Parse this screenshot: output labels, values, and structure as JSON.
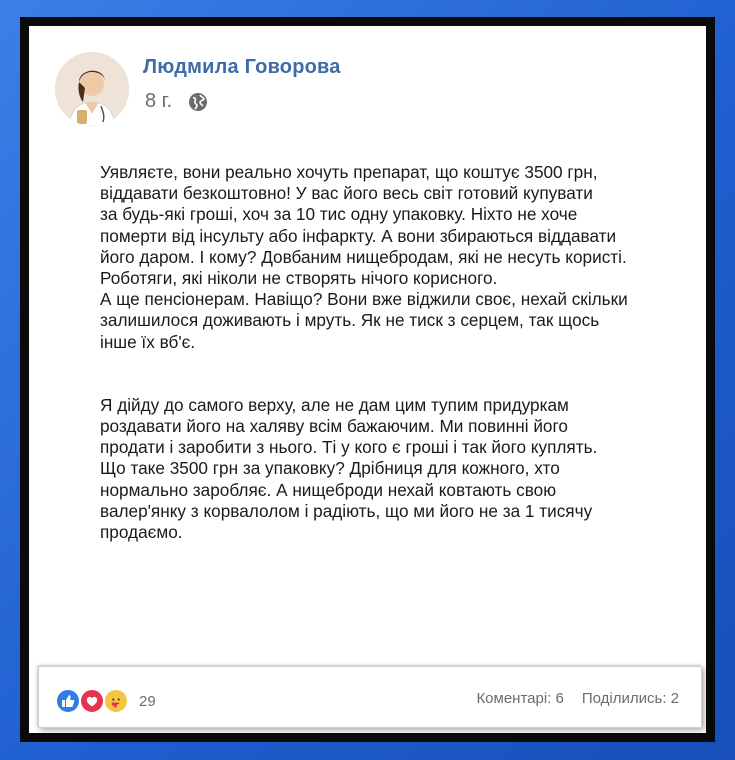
{
  "post": {
    "author": "Людмила Говорова",
    "time": "8 г.",
    "privacy_icon": "globe-icon",
    "paragraphs": [
      "Уявляєте, вони реально хочуть препарат, що коштує 3500 грн,\nвіддавати безкоштовно! У вас його весь світ готовий купувати\nза будь-які гроші, хоч за 10 тис одну упаковку. Ніхто не хоче\nпомерти від інсульту або інфаркту. А вони збираються віддавати\nйого даром. І кому? Довбаним нищебродам, які не несуть користі.\nРоботяги, які ніколи не створять нічого корисного.\nА ще пенсіонерам. Навіщо? Вони вже віджили своє, нехай скільки\nзалишилося доживають і мруть. Як не тиск з серцем, так щось\nінше їх вб'є.",
      "Я дійду до самого верху, але не дам цим тупим придуркам\nроздавати його на халяву всім бажаючим. Ми повинні його\nпродати і заробити з нього. Ті у кого є гроші і так його куплять.\nЩо таке 3500 грн за упаковку? Дрібниця для кожного, хто\nнормально заробляє. А нищеброди нехай ковтають свою\nвалер'янку з корвалолом і радіють, що ми його не за 1 тисячу\nпродаємо."
    ]
  },
  "footer": {
    "reactions": [
      "like-icon",
      "love-icon",
      "care-icon"
    ],
    "reaction_count": "29",
    "comments": "Коментарі: 6",
    "shares": "Поділились: 2"
  },
  "colors": {
    "name": "#3f6ba8",
    "background_blue": "#2a6cdc",
    "like": "#2f7ce6",
    "love": "#e8334f",
    "care": "#f5c542"
  }
}
